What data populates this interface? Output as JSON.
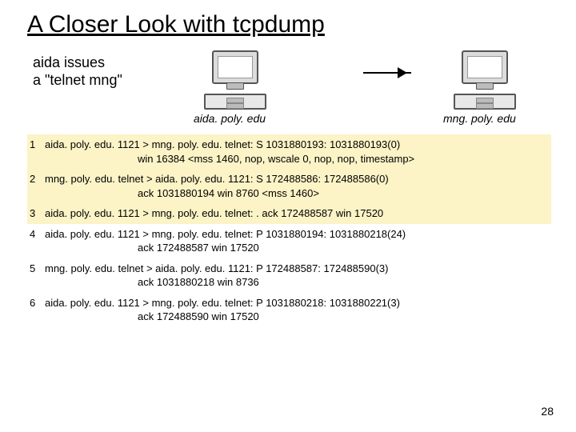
{
  "title": "A Closer Look with tcpdump",
  "caption": {
    "line1": "aida issues",
    "line2": "a  \"telnet mng\""
  },
  "hosts": {
    "h1": "aida. poly. edu",
    "h2": "mng. poly. edu"
  },
  "rows": [
    {
      "n": "1",
      "a": "aida. poly. edu. 1121 > mng. poly. edu. telnet: S 1031880193: 1031880193(0)",
      "b": "win 16384 <mss 1460, nop, wscale 0, nop, nop, timestamp>",
      "hl": true
    },
    {
      "n": "2",
      "a": "mng. poly. edu. telnet > aida. poly. edu. 1121: S 172488586: 172488586(0)",
      "b": "ack 1031880194 win 8760 <mss 1460>",
      "hl": true
    },
    {
      "n": "3",
      "a": "aida. poly. edu. 1121 > mng. poly. edu. telnet: . ack 172488587 win 17520",
      "b": "",
      "hl": true
    },
    {
      "n": "4",
      "a": "aida. poly. edu. 1121 > mng. poly. edu. telnet: P 1031880194: 1031880218(24)",
      "b": "ack 172488587 win 17520",
      "hl": false
    },
    {
      "n": "5",
      "a": "mng. poly. edu. telnet > aida. poly. edu. 1121: P 172488587: 172488590(3)",
      "b": "ack 1031880218 win 8736",
      "hl": false
    },
    {
      "n": "6",
      "a": "aida. poly. edu. 1121 > mng. poly. edu. telnet: P 1031880218: 1031880221(3)",
      "b": "ack 172488590 win 17520",
      "hl": false
    }
  ],
  "page": "28"
}
